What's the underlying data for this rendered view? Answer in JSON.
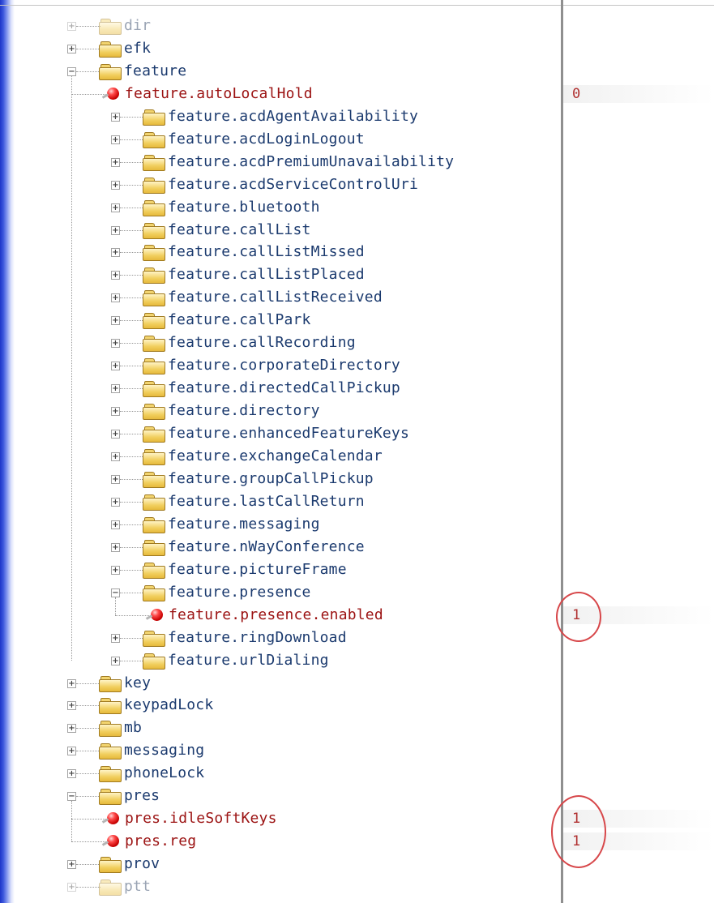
{
  "tree": [
    {
      "label": "dir",
      "kind": "folder",
      "depth": 0,
      "state": "collapsed",
      "faded": true
    },
    {
      "label": "efk",
      "kind": "folder",
      "depth": 0,
      "state": "collapsed"
    },
    {
      "label": "feature",
      "kind": "folder",
      "depth": 0,
      "state": "expanded"
    },
    {
      "label": "feature.autoLocalHold",
      "kind": "param",
      "depth": 1,
      "value": "0"
    },
    {
      "label": "feature.acdAgentAvailability",
      "kind": "folder",
      "depth": 1,
      "state": "collapsed"
    },
    {
      "label": "feature.acdLoginLogout",
      "kind": "folder",
      "depth": 1,
      "state": "collapsed"
    },
    {
      "label": "feature.acdPremiumUnavailability",
      "kind": "folder",
      "depth": 1,
      "state": "collapsed"
    },
    {
      "label": "feature.acdServiceControlUri",
      "kind": "folder",
      "depth": 1,
      "state": "collapsed"
    },
    {
      "label": "feature.bluetooth",
      "kind": "folder",
      "depth": 1,
      "state": "collapsed"
    },
    {
      "label": "feature.callList",
      "kind": "folder",
      "depth": 1,
      "state": "collapsed"
    },
    {
      "label": "feature.callListMissed",
      "kind": "folder",
      "depth": 1,
      "state": "collapsed"
    },
    {
      "label": "feature.callListPlaced",
      "kind": "folder",
      "depth": 1,
      "state": "collapsed"
    },
    {
      "label": "feature.callListReceived",
      "kind": "folder",
      "depth": 1,
      "state": "collapsed"
    },
    {
      "label": "feature.callPark",
      "kind": "folder",
      "depth": 1,
      "state": "collapsed"
    },
    {
      "label": "feature.callRecording",
      "kind": "folder",
      "depth": 1,
      "state": "collapsed"
    },
    {
      "label": "feature.corporateDirectory",
      "kind": "folder",
      "depth": 1,
      "state": "collapsed"
    },
    {
      "label": "feature.directedCallPickup",
      "kind": "folder",
      "depth": 1,
      "state": "collapsed"
    },
    {
      "label": "feature.directory",
      "kind": "folder",
      "depth": 1,
      "state": "collapsed"
    },
    {
      "label": "feature.enhancedFeatureKeys",
      "kind": "folder",
      "depth": 1,
      "state": "collapsed"
    },
    {
      "label": "feature.exchangeCalendar",
      "kind": "folder",
      "depth": 1,
      "state": "collapsed"
    },
    {
      "label": "feature.groupCallPickup",
      "kind": "folder",
      "depth": 1,
      "state": "collapsed"
    },
    {
      "label": "feature.lastCallReturn",
      "kind": "folder",
      "depth": 1,
      "state": "collapsed"
    },
    {
      "label": "feature.messaging",
      "kind": "folder",
      "depth": 1,
      "state": "collapsed"
    },
    {
      "label": "feature.nWayConference",
      "kind": "folder",
      "depth": 1,
      "state": "collapsed"
    },
    {
      "label": "feature.pictureFrame",
      "kind": "folder",
      "depth": 1,
      "state": "collapsed"
    },
    {
      "label": "feature.presence",
      "kind": "folder",
      "depth": 1,
      "state": "expanded"
    },
    {
      "label": "feature.presence.enabled",
      "kind": "param",
      "depth": 2,
      "value": "1",
      "circled": true
    },
    {
      "label": "feature.ringDownload",
      "kind": "folder",
      "depth": 1,
      "state": "collapsed"
    },
    {
      "label": "feature.urlDialing",
      "kind": "folder",
      "depth": 1,
      "state": "collapsed"
    },
    {
      "label": "key",
      "kind": "folder",
      "depth": 0,
      "state": "collapsed"
    },
    {
      "label": "keypadLock",
      "kind": "folder",
      "depth": 0,
      "state": "collapsed"
    },
    {
      "label": "mb",
      "kind": "folder",
      "depth": 0,
      "state": "collapsed"
    },
    {
      "label": "messaging",
      "kind": "folder",
      "depth": 0,
      "state": "collapsed"
    },
    {
      "label": "phoneLock",
      "kind": "folder",
      "depth": 0,
      "state": "collapsed"
    },
    {
      "label": "pres",
      "kind": "folder",
      "depth": 0,
      "state": "expanded"
    },
    {
      "label": "pres.idleSoftKeys",
      "kind": "param",
      "depth": 1,
      "value": "1",
      "circled": true
    },
    {
      "label": "pres.reg",
      "kind": "param",
      "depth": 1,
      "value": "1",
      "circled": true
    },
    {
      "label": "prov",
      "kind": "folder",
      "depth": 0,
      "state": "collapsed"
    },
    {
      "label": "ptt",
      "kind": "folder",
      "depth": 0,
      "state": "collapsed",
      "faded": true
    }
  ],
  "colors": {
    "folder_text": "#1b3a6e",
    "param_text": "#9b1212",
    "value_text": "#b03030",
    "callout": "#d7474a",
    "separator": "#8f8f8f"
  }
}
